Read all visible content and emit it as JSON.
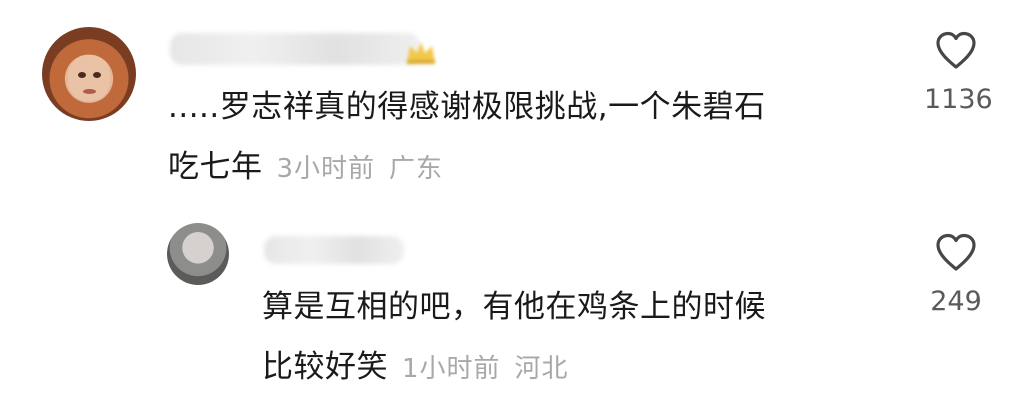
{
  "comment": {
    "text_line1": ".....罗志祥真的得感谢极限挑战,一个朱碧石",
    "text_line2": "吃七年",
    "time": "3小时前",
    "location": "广东",
    "likes": "1136"
  },
  "reply": {
    "text_line1": "算是互相的吧，有他在鸡条上的时候",
    "text_line2": "比较好笑",
    "time": "1小时前",
    "location": "河北",
    "likes": "249"
  },
  "icons": {
    "like": "heart-outline-icon"
  }
}
